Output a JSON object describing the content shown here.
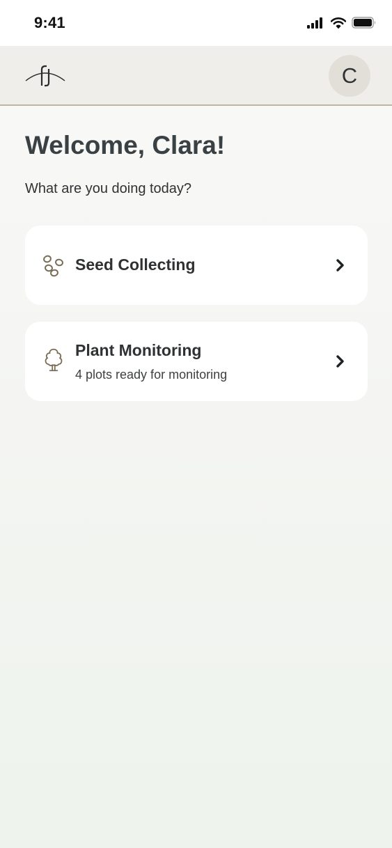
{
  "status_bar": {
    "time": "9:41",
    "icons": [
      "cellular-signal-icon",
      "wifi-icon",
      "battery-icon"
    ]
  },
  "header": {
    "logo": "app-logo",
    "avatar_initial": "C"
  },
  "main": {
    "welcome_title": "Welcome, Clara!",
    "welcome_subtitle": "What are you doing today?",
    "cards": [
      {
        "title": "Seed Collecting",
        "subtitle": "",
        "icon": "seeds-icon",
        "trailing_icon": "chevron-right-icon"
      },
      {
        "title": "Plant Monitoring",
        "subtitle": "4 plots ready for monitoring",
        "icon": "tree-icon",
        "trailing_icon": "chevron-right-icon"
      }
    ]
  },
  "colors": {
    "header_background": "#efeeea",
    "header_border": "#bdb6a3",
    "avatar_background": "#e2dfd8",
    "icon_accent": "#7a6c55",
    "title_text": "#3a4145",
    "card_background": "#ffffff"
  }
}
